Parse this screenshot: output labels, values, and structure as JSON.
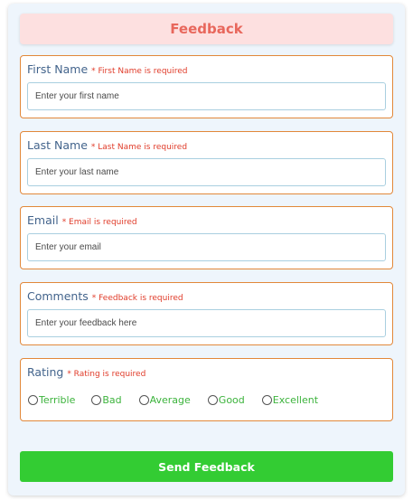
{
  "form": {
    "title": "Feedback",
    "fields": [
      {
        "label": "First Name",
        "error": "* First Name is required",
        "placeholder": "Enter your first name"
      },
      {
        "label": "Last Name",
        "error": "* Last Name is required",
        "placeholder": "Enter your last name"
      },
      {
        "label": "Email",
        "error": "* Email is required",
        "placeholder": "Enter your email"
      },
      {
        "label": "Comments",
        "error": "* Feedback is required",
        "placeholder": "Enter your feedback here"
      }
    ],
    "rating": {
      "label": "Rating",
      "error": "* Rating is required",
      "options": [
        "Terrible",
        "Bad",
        "Average",
        "Good",
        "Excellent"
      ]
    },
    "submit_label": "Send Feedback"
  },
  "colors": {
    "panel_bg": "#eef5fc",
    "header_bg": "#fde0e0",
    "header_text": "#e8675c",
    "field_border": "#e2883a",
    "label_text": "#43648c",
    "error_text": "#e03c2a",
    "option_text": "#3cb33c",
    "button_bg": "#33cc33"
  }
}
